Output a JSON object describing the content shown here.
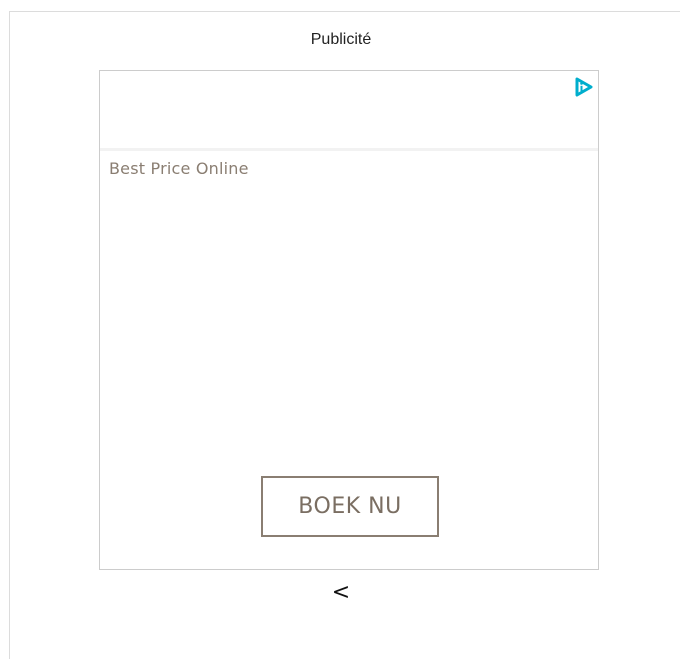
{
  "ad": {
    "label": "Publicité",
    "tagline": "Best Price Online",
    "cta_label": "BOEK NU",
    "adchoices_icon": "adchoices-icon",
    "accent_color": "#00aecd",
    "text_color": "#8a7e72"
  },
  "nav": {
    "prev_label": "<"
  }
}
